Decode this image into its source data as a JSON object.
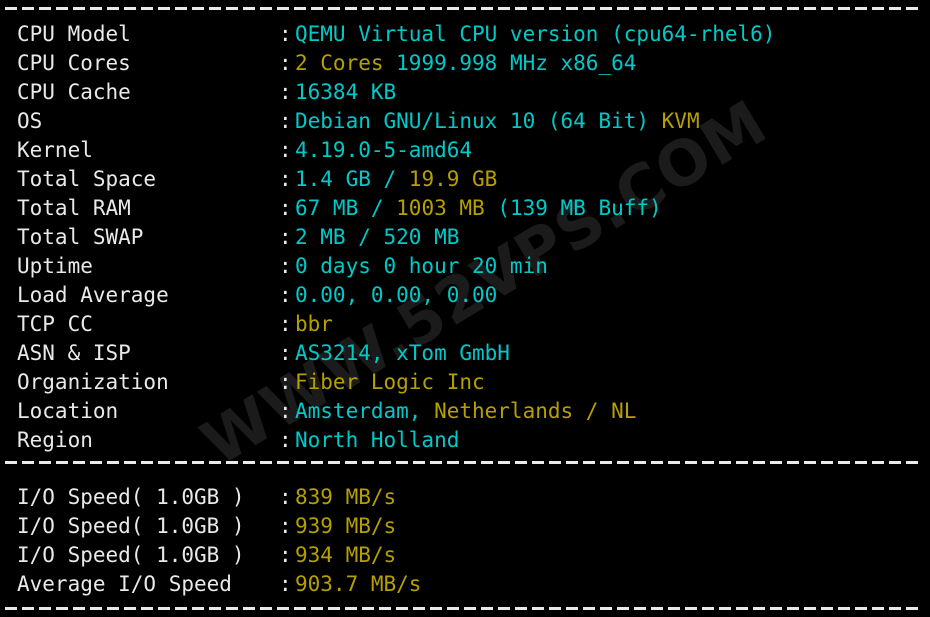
{
  "terminal": {
    "background_color": "#000000",
    "label_color": "#e9e9e9",
    "cyan_color": "#00c9c9",
    "yellow_color": "#b5a000",
    "separator": "------------------------------------------------------------",
    "colon": ":"
  },
  "watermark": {
    "text": "WWW.52VPS.COM",
    "color": "#1b1b1b"
  },
  "system_info": {
    "rows": [
      {
        "label": "CPU Model",
        "value": "QEMU Virtual CPU version (cpu64-rhel6)",
        "parts": [
          {
            "text": "QEMU Virtual CPU version (cpu64-rhel6)",
            "color": "cyan"
          }
        ]
      },
      {
        "label": "CPU Cores",
        "value": "2 Cores 1999.998 MHz x86_64",
        "parts": [
          {
            "text": "2 Cores",
            "color": "yellow"
          },
          {
            "text": " 1999.998 MHz x86_64",
            "color": "cyan"
          }
        ]
      },
      {
        "label": "CPU Cache",
        "value": "16384 KB",
        "parts": [
          {
            "text": "16384 KB",
            "color": "cyan"
          }
        ]
      },
      {
        "label": "OS",
        "value": "Debian GNU/Linux 10 (64 Bit) KVM",
        "parts": [
          {
            "text": "Debian GNU/Linux 10 (64 Bit) ",
            "color": "cyan"
          },
          {
            "text": "KVM",
            "color": "yellow"
          }
        ]
      },
      {
        "label": "Kernel",
        "value": "4.19.0-5-amd64",
        "parts": [
          {
            "text": "4.19.0-5-amd64",
            "color": "cyan"
          }
        ]
      },
      {
        "label": "Total Space",
        "value": "1.4 GB / 19.9 GB",
        "parts": [
          {
            "text": "1.4 GB / ",
            "color": "cyan"
          },
          {
            "text": "19.9 GB",
            "color": "yellow"
          }
        ]
      },
      {
        "label": "Total RAM",
        "value": "67 MB / 1003 MB (139 MB Buff)",
        "parts": [
          {
            "text": "67 MB / ",
            "color": "cyan"
          },
          {
            "text": "1003 MB",
            "color": "yellow"
          },
          {
            "text": " (139 MB Buff)",
            "color": "cyan"
          }
        ]
      },
      {
        "label": "Total SWAP",
        "value": "2 MB / 520 MB",
        "parts": [
          {
            "text": "2 MB / 520 MB",
            "color": "cyan"
          }
        ]
      },
      {
        "label": "Uptime",
        "value": "0 days 0 hour 20 min",
        "parts": [
          {
            "text": "0 days 0 hour 20 min",
            "color": "cyan"
          }
        ]
      },
      {
        "label": "Load Average",
        "value": "0.00, 0.00, 0.00",
        "parts": [
          {
            "text": "0.00, 0.00, 0.00",
            "color": "cyan"
          }
        ]
      },
      {
        "label": "TCP CC",
        "value": "bbr",
        "parts": [
          {
            "text": "bbr",
            "color": "yellow"
          }
        ]
      },
      {
        "label": "ASN & ISP",
        "value": "AS3214, xTom GmbH",
        "parts": [
          {
            "text": "AS3214, xTom GmbH",
            "color": "cyan"
          }
        ]
      },
      {
        "label": "Organization",
        "value": "Fiber Logic Inc",
        "parts": [
          {
            "text": "Fiber Logic Inc",
            "color": "yellow"
          }
        ]
      },
      {
        "label": "Location",
        "value": "Amsterdam, Netherlands / NL",
        "parts": [
          {
            "text": "Amsterdam, ",
            "color": "cyan"
          },
          {
            "text": "Netherlands / NL",
            "color": "yellow"
          }
        ]
      },
      {
        "label": "Region",
        "value": "North Holland",
        "parts": [
          {
            "text": "North Holland",
            "color": "cyan"
          }
        ]
      }
    ]
  },
  "io_speed": {
    "rows": [
      {
        "label": "I/O Speed( 1.0GB )",
        "value": "839 MB/s",
        "parts": [
          {
            "text": "839 MB/s",
            "color": "yellow"
          }
        ]
      },
      {
        "label": "I/O Speed( 1.0GB )",
        "value": "939 MB/s",
        "parts": [
          {
            "text": "939 MB/s",
            "color": "yellow"
          }
        ]
      },
      {
        "label": "I/O Speed( 1.0GB )",
        "value": "934 MB/s",
        "parts": [
          {
            "text": "934 MB/s",
            "color": "yellow"
          }
        ]
      },
      {
        "label": "Average I/O Speed",
        "value": "903.7 MB/s",
        "parts": [
          {
            "text": "903.7 MB/s",
            "color": "yellow"
          }
        ]
      }
    ]
  }
}
